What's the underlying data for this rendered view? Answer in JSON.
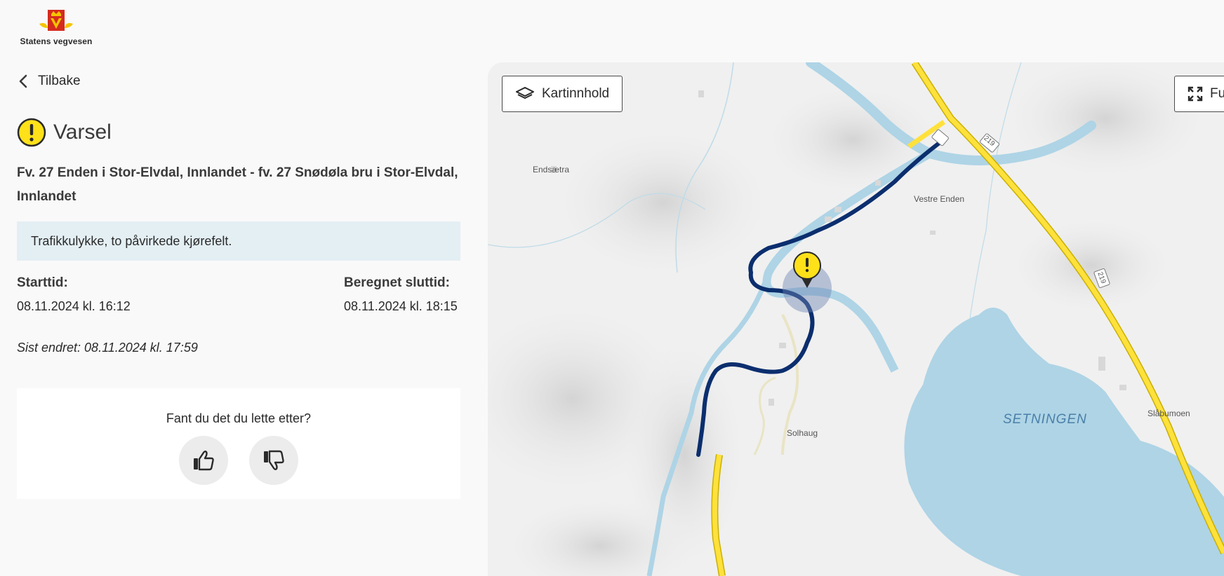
{
  "brand": {
    "name": "Statens vegvesen",
    "color_red": "#d52b1e",
    "color_yellow": "#f5c400"
  },
  "nav": {
    "back_label": "Tilbake"
  },
  "notice": {
    "type_label": "Varsel",
    "icon": "warning-icon",
    "icon_color": "#ffe11a",
    "road": "Fv. 27 Enden i Stor-Elvdal, Innlandet - fv. 27 Snødøla bru i Stor-Elvdal, Innlandet",
    "message": "Trafikkulykke, to påvirkede kjørefelt.",
    "start_label": "Starttid:",
    "start_value": "08.11.2024 kl. 16:12",
    "end_label": "Beregnet sluttid:",
    "end_value": "08.11.2024 kl. 18:15",
    "last_changed": "Sist endret: 08.11.2024 kl. 17:59"
  },
  "feedback": {
    "question": "Fant du det du lette etter?",
    "up_icon": "thumbs-up-icon",
    "down_icon": "thumbs-down-icon"
  },
  "map": {
    "layers_button_label": "Kartinnhold",
    "fullscreen_button_label": "Fu",
    "place_labels": [
      "Endsætra",
      "Vestre Enden",
      "Solhaug",
      "Slåbumoen"
    ],
    "lake_label": "SETNINGEN",
    "road_shields": [
      "219",
      "219"
    ],
    "route_color": "#0b2e6e",
    "road_color": "#ffe13c",
    "water_color": "#aed4e6"
  }
}
